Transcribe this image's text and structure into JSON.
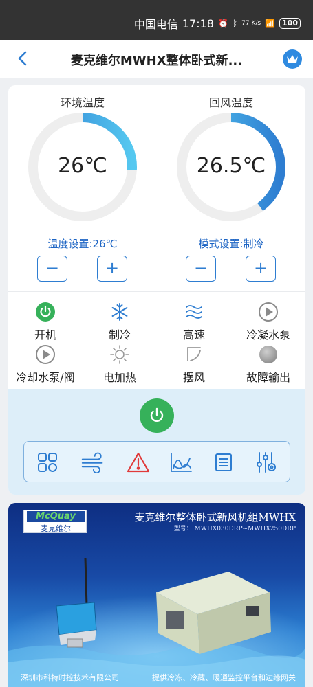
{
  "status_bar": {
    "carrier": "中国电信",
    "time": "17:18",
    "net_speed": "77 K/s",
    "battery": "100"
  },
  "nav": {
    "title": "麦克维尔MWHX整体卧式新..."
  },
  "gauges": [
    {
      "title": "环境温度",
      "value": "26℃",
      "fill": 0.26,
      "color": "#2e7dd1"
    },
    {
      "title": "回风温度",
      "value": "26.5℃",
      "fill": 0.4,
      "color": "#2e7dd1"
    }
  ],
  "settings": {
    "temp": "温度设置:26℃",
    "mode": "模式设置:制冷"
  },
  "buttons": {
    "minus": "−",
    "plus": "+"
  },
  "status_items": [
    {
      "label": "开机",
      "icon": "power-on-icon"
    },
    {
      "label": "制冷",
      "icon": "snowflake-icon"
    },
    {
      "label": "高速",
      "icon": "wind-speed-icon"
    },
    {
      "label": "冷凝水泵",
      "icon": "play-circle-icon"
    },
    {
      "label": "冷却水泵/阀",
      "icon": "play-circle-icon"
    },
    {
      "label": "电加热",
      "icon": "sun-icon"
    },
    {
      "label": "摆风",
      "icon": "swing-icon"
    },
    {
      "label": "故障输出",
      "icon": "fault-dot-icon"
    }
  ],
  "toolbar_icons": [
    "grid-icon",
    "wind-icon",
    "alarm-icon",
    "chart-icon",
    "list-icon",
    "settings-sliders-icon"
  ],
  "banner": {
    "logo_top": "McQuay",
    "logo_bottom": "麦克维尔",
    "title": "麦克维尔整体卧式新风机组MWHX",
    "model": "型号： MWHX030DRP~MWHX250DRP",
    "company": "深圳市科特时控技术有限公司",
    "service": "提供冷冻、冷藏、暖通监控平台和边缘网关"
  },
  "colors": {
    "accent": "#2e7dd1",
    "power_green": "#36b15a",
    "alarm_red": "#e03a3a"
  }
}
